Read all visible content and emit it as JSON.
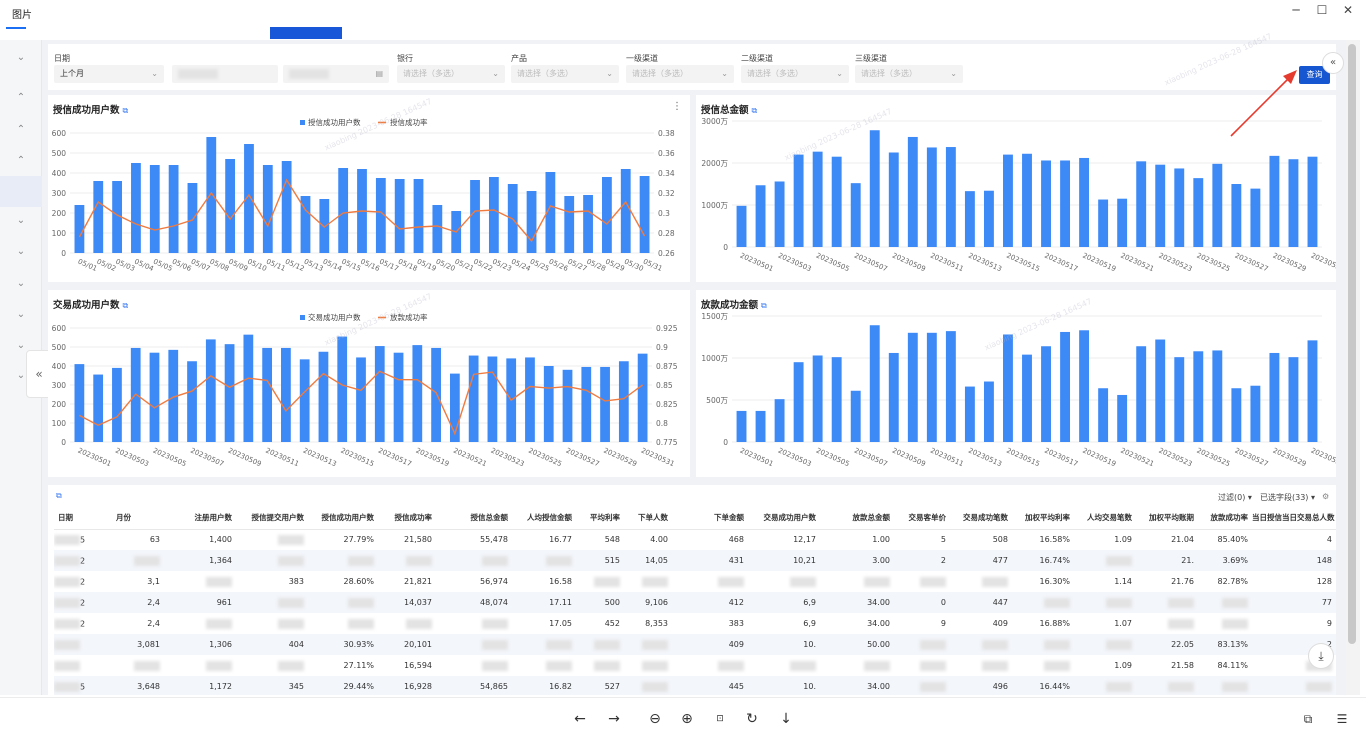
{
  "app": {
    "title": "图片"
  },
  "filters": [
    {
      "label": "日期",
      "value": "上个月"
    },
    {
      "label": "银行",
      "placeholder": "请选择（多选）"
    },
    {
      "label": "产品",
      "placeholder": "请选择（多选）"
    },
    {
      "label": "一级渠道",
      "placeholder": "请选择（多选）"
    },
    {
      "label": "二级渠道",
      "placeholder": "请选择（多选）"
    },
    {
      "label": "三级渠道",
      "placeholder": "请选择（多选）"
    }
  ],
  "search_label": "查询",
  "watermark": "xiaobing 2023-06-28 164547",
  "colors": {
    "bar": "#3d8af7",
    "line": "#f07b3f",
    "accent": "#1656d0",
    "arrow": "#e53a2e"
  },
  "chart_data": [
    {
      "type": "bar",
      "title": "授信成功用户数",
      "legend": [
        "授信成功用户数",
        "授信成功率"
      ],
      "legend_position": "top-center",
      "categories": [
        "05/01",
        "05/02",
        "05/03",
        "05/04",
        "05/05",
        "05/06",
        "05/07",
        "05/08",
        "05/09",
        "05/10",
        "05/11",
        "05/12",
        "05/13",
        "05/14",
        "05/15",
        "05/16",
        "05/17",
        "05/18",
        "05/19",
        "05/20",
        "05/21",
        "05/22",
        "05/23",
        "05/24",
        "05/25",
        "05/26",
        "05/27",
        "05/28",
        "05/29",
        "05/30",
        "05/31"
      ],
      "tick_labels": [
        "05/01",
        "05/02",
        "05/03",
        "05/04",
        "05/05",
        "05/06",
        "05/07",
        "05/08",
        "05/09",
        "05/10",
        "05/11",
        "05/12",
        "05/13",
        "05/14",
        "05/15",
        "05/16",
        "05/17",
        "05/18",
        "05/19",
        "05/20",
        "05/21",
        "05/22",
        "05/23",
        "05/24",
        "05/25",
        "05/26",
        "05/27",
        "05/28",
        "05/29",
        "05/30",
        "05/31"
      ],
      "series": [
        {
          "name": "授信成功用户数",
          "type": "bar",
          "axis": "left",
          "values": [
            240,
            360,
            360,
            450,
            440,
            440,
            350,
            580,
            470,
            545,
            440,
            460,
            285,
            270,
            425,
            420,
            375,
            370,
            370,
            240,
            210,
            365,
            380,
            345,
            310,
            405,
            285,
            290,
            380,
            420,
            385
          ]
        },
        {
          "name": "授信成功率",
          "type": "line",
          "axis": "right",
          "values": [
            0.276,
            0.311,
            0.298,
            0.289,
            0.283,
            0.287,
            0.293,
            0.32,
            0.294,
            0.318,
            0.287,
            0.333,
            0.303,
            0.286,
            0.3,
            0.302,
            0.301,
            0.284,
            0.286,
            0.287,
            0.281,
            0.302,
            0.303,
            0.294,
            0.272,
            0.307,
            0.301,
            0.302,
            0.289,
            0.311,
            0.277
          ]
        }
      ],
      "ylim": [
        0,
        600
      ],
      "y_ticks": [
        "0",
        "100",
        "200",
        "300",
        "400",
        "500",
        "600"
      ],
      "y2lim": [
        0.26,
        0.38
      ],
      "y2_ticks": [
        "0.26",
        "0.28",
        "0.3",
        "0.32",
        "0.34",
        "0.36",
        "0.38"
      ],
      "grid": true
    },
    {
      "type": "bar",
      "title": "授信总金额",
      "categories": [
        "20230501",
        "20230502",
        "20230503",
        "20230504",
        "20230505",
        "20230506",
        "20230507",
        "20230508",
        "20230509",
        "20230510",
        "20230511",
        "20230512",
        "20230513",
        "20230514",
        "20230515",
        "20230516",
        "20230517",
        "20230518",
        "20230519",
        "20230520",
        "20230521",
        "20230522",
        "20230523",
        "20230524",
        "20230525",
        "20230526",
        "20230527",
        "20230528",
        "20230529",
        "20230530",
        "20230531"
      ],
      "tick_labels": [
        "20230501",
        "20230503",
        "20230505",
        "20230507",
        "20230509",
        "20230511",
        "20230513",
        "20230515",
        "20230517",
        "20230519",
        "20230521",
        "20230523",
        "20230525",
        "20230527",
        "20230529",
        "20230531"
      ],
      "series": [
        {
          "name": "",
          "values": [
            980,
            1470,
            1560,
            2200,
            2270,
            2150,
            1520,
            2780,
            2250,
            2620,
            2370,
            2380,
            1330,
            1340,
            2200,
            2220,
            2060,
            2060,
            2120,
            1130,
            1150,
            2040,
            1960,
            1870,
            1640,
            1980,
            1500,
            1390,
            2170,
            2090,
            2150
          ]
        }
      ],
      "ylim": [
        0,
        3000
      ],
      "y_ticks": [
        "0",
        "1000万",
        "2000万",
        "3000万"
      ],
      "grid": true
    },
    {
      "type": "bar",
      "title": "交易成功用户数",
      "legend": [
        "交易成功用户数",
        "放款成功率"
      ],
      "legend_position": "top-center",
      "categories": [
        "20230501",
        "20230502",
        "20230503",
        "20230504",
        "20230505",
        "20230506",
        "20230507",
        "20230508",
        "20230509",
        "20230510",
        "20230511",
        "20230512",
        "20230513",
        "20230514",
        "20230515",
        "20230516",
        "20230517",
        "20230518",
        "20230519",
        "20230520",
        "20230521",
        "20230522",
        "20230523",
        "20230524",
        "20230525",
        "20230526",
        "20230527",
        "20230528",
        "20230529",
        "20230530",
        "20230531"
      ],
      "tick_labels": [
        "20230501",
        "20230503",
        "20230505",
        "20230507",
        "20230509",
        "20230511",
        "20230513",
        "20230515",
        "20230517",
        "20230519",
        "20230521",
        "20230523",
        "20230525",
        "20230527",
        "20230529",
        "20230531"
      ],
      "series": [
        {
          "name": "交易成功用户数",
          "type": "bar",
          "axis": "left",
          "values": [
            410,
            355,
            390,
            495,
            470,
            485,
            425,
            540,
            515,
            565,
            495,
            495,
            435,
            475,
            555,
            445,
            505,
            470,
            510,
            495,
            360,
            455,
            450,
            440,
            445,
            400,
            380,
            395,
            395,
            425,
            465
          ]
        },
        {
          "name": "放款成功率",
          "type": "line",
          "axis": "right",
          "values": [
            0.81,
            0.797,
            0.808,
            0.838,
            0.82,
            0.834,
            0.842,
            0.862,
            0.847,
            0.859,
            0.856,
            0.816,
            0.841,
            0.865,
            0.85,
            0.843,
            0.868,
            0.857,
            0.857,
            0.84,
            0.786,
            0.864,
            0.867,
            0.83,
            0.848,
            0.846,
            0.848,
            0.843,
            0.829,
            0.832,
            0.85
          ]
        }
      ],
      "ylim": [
        0,
        600
      ],
      "y_ticks": [
        "0",
        "100",
        "200",
        "300",
        "400",
        "500",
        "600"
      ],
      "y2lim": [
        0.775,
        0.925
      ],
      "y2_ticks": [
        "0.775",
        "0.8",
        "0.825",
        "0.85",
        "0.875",
        "0.9",
        "0.925"
      ],
      "grid": true
    },
    {
      "type": "bar",
      "title": "放款成功金额",
      "categories": [
        "20230501",
        "20230502",
        "20230503",
        "20230504",
        "20230505",
        "20230506",
        "20230507",
        "20230508",
        "20230509",
        "20230510",
        "20230511",
        "20230512",
        "20230513",
        "20230514",
        "20230515",
        "20230516",
        "20230517",
        "20230518",
        "20230519",
        "20230520",
        "20230521",
        "20230522",
        "20230523",
        "20230524",
        "20230525",
        "20230526",
        "20230527",
        "20230528",
        "20230529",
        "20230530",
        "20230531"
      ],
      "tick_labels": [
        "20230501",
        "20230503",
        "20230505",
        "20230507",
        "20230509",
        "20230511",
        "20230513",
        "20230515",
        "20230517",
        "20230519",
        "20230521",
        "20230523",
        "20230525",
        "20230527",
        "20230529",
        "20230531"
      ],
      "series": [
        {
          "name": "",
          "values": [
            370,
            370,
            510,
            950,
            1030,
            1010,
            610,
            1390,
            1060,
            1300,
            1300,
            1320,
            660,
            720,
            1280,
            1040,
            1140,
            1310,
            1330,
            640,
            560,
            1140,
            1220,
            1010,
            1080,
            1090,
            640,
            670,
            1060,
            1010,
            1210
          ]
        }
      ],
      "ylim": [
        0,
        1500
      ],
      "y_ticks": [
        "0",
        "500万",
        "1000万",
        "1500万"
      ],
      "grid": true
    }
  ],
  "table": {
    "tools": {
      "filter": "过滤(0)",
      "fields": "已选字段(33)"
    },
    "headers": [
      "日期",
      "月份",
      "注册用户数",
      "授信提交用户数",
      "授信成功用户数",
      "授信成功率",
      "授信总金额",
      "人均授信金额",
      "平均利率",
      "下单人数",
      "下单金额",
      "交易成功用户数",
      "放款总金额",
      "交易客单价",
      "交易成功笔数",
      "加权平均利率",
      "人均交易笔数",
      "加权平均账期",
      "放款成功率",
      "当日授信当日交易总人数"
    ],
    "rows": [
      [
        "",
        "5",
        "63",
        "1,400",
        "",
        "27.79%",
        "21,580",
        "55,478",
        "16.77",
        "548",
        "4.00",
        "468",
        "12,17",
        "1.00",
        "5",
        "508",
        "16.58%",
        "1.09",
        "21.04",
        "85.40%",
        "4"
      ],
      [
        "",
        "2",
        "",
        "1,364",
        "",
        "",
        "",
        "",
        "",
        "515",
        "14,05",
        "431",
        "10,21",
        "3.00",
        "2",
        "477",
        "16.74%",
        "",
        "21.",
        "3.69%",
        "148"
      ],
      [
        "",
        "2",
        "3,1",
        "",
        "383",
        "28.60%",
        "21,821",
        "56,974",
        "16.58",
        "",
        "",
        "",
        "",
        "",
        "",
        "",
        "16.30%",
        "1.14",
        "21.76",
        "82.78%",
        "128"
      ],
      [
        "",
        "2",
        "2,4",
        "961",
        "",
        "",
        "14,037",
        "48,074",
        "17.11",
        "500",
        "9,106",
        "412",
        "6,9",
        "34.00",
        "0",
        "447",
        "",
        "",
        "",
        "",
        "77"
      ],
      [
        "",
        "2",
        "2,4",
        "",
        "",
        "",
        "",
        "",
        "17.05",
        "452",
        "8,353",
        "383",
        "6,9",
        "34.00",
        "9",
        "409",
        "16.88%",
        "1.07",
        "",
        "",
        "9"
      ],
      [
        "",
        "",
        "3,081",
        "1,306",
        "404",
        "30.93%",
        "20,101",
        "",
        "",
        "",
        "",
        "409",
        "10.",
        "50.00",
        "",
        "",
        "",
        "",
        "22.05",
        "83.13%",
        "2"
      ],
      [
        "",
        "",
        "",
        "",
        "",
        "27.11%",
        "16,594",
        "",
        "",
        "",
        "",
        "",
        "",
        "",
        "",
        "",
        "",
        "1.09",
        "21.58",
        "84.11%",
        ""
      ],
      [
        "",
        "5",
        "3,648",
        "1,172",
        "345",
        "29.44%",
        "16,928",
        "54,865",
        "16.82",
        "527",
        "",
        "445",
        "10.",
        "34.00",
        "",
        "496",
        "16.44%",
        "",
        "",
        "",
        ""
      ]
    ]
  }
}
